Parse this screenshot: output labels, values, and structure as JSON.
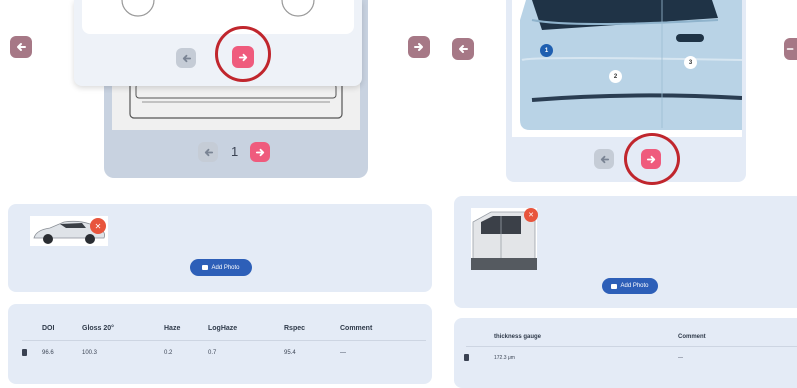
{
  "left_panel": {
    "inner_page_number": "1",
    "table": {
      "headers": [
        "DOI",
        "Gloss 20°",
        "Haze",
        "LogHaze",
        "Rspec",
        "Comment"
      ],
      "row": [
        "96.6",
        "100.3",
        "0.2",
        "0.7",
        "95.4",
        "—"
      ]
    },
    "add_photo_label": "Add Photo"
  },
  "right_panel": {
    "door_points": [
      "1",
      "2",
      "3"
    ],
    "table": {
      "headers": [
        "thickness gauge",
        "Comment"
      ],
      "row": [
        "172.3 μm",
        "—"
      ]
    },
    "add_photo_label": "Add Photo"
  },
  "colors": {
    "accent_pink": "#ef5b7d",
    "nav_mauve": "#a67886",
    "highlight_ring": "#c0262d",
    "add_photo_blue": "#2d5fb8",
    "panel_bg": "#e4ebf6"
  },
  "icons": {
    "arrow_left": "arrow-left-icon",
    "arrow_right": "arrow-right-icon",
    "trash": "trash-icon",
    "close": "close-icon",
    "camera": "camera-icon"
  }
}
